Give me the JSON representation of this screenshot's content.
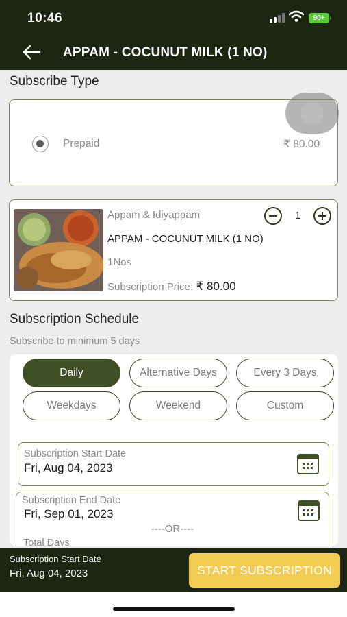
{
  "status_bar": {
    "time": "10:46",
    "battery": "90+"
  },
  "app_bar": {
    "title": "APPAM - COCUNUT MILK (1 NO)",
    "back_icon": "arrow-left-icon"
  },
  "subscribe_type": {
    "heading": "Subscribe Type",
    "option_label": "Prepaid",
    "option_price": "₹ 80.00"
  },
  "product": {
    "category": "Appam & Idiyappam",
    "name": "APPAM - COCUNUT MILK (1 NO)",
    "unit": "1Nos",
    "price_label": "Subscription Price:",
    "price_value": "₹ 80.00",
    "quantity": "1"
  },
  "schedule": {
    "heading": "Subscription Schedule",
    "hint": "Subscribe to minimum 5 days",
    "options": [
      "Daily",
      "Alternative Days",
      "Every 3 Days",
      "Weekdays",
      "Weekend",
      "Custom"
    ],
    "selected": "Daily",
    "start_label": "Subscription Start Date",
    "start_value": "Fri, Aug 04, 2023",
    "end_label": "Subscription End Date",
    "end_value": "Fri, Sep 01, 2023",
    "or_text": "----OR----",
    "total_days_label": "Total Days"
  },
  "footer": {
    "start_label": "Subscription Start Date",
    "start_value": "Fri, Aug 04, 2023",
    "cta_label": "START SUBSCRIPTION"
  },
  "colors": {
    "header_bg": "#1d2612",
    "accent": "#3e4f26",
    "card_border": "#7f8a52",
    "cta_bg": "#f3cb52"
  }
}
